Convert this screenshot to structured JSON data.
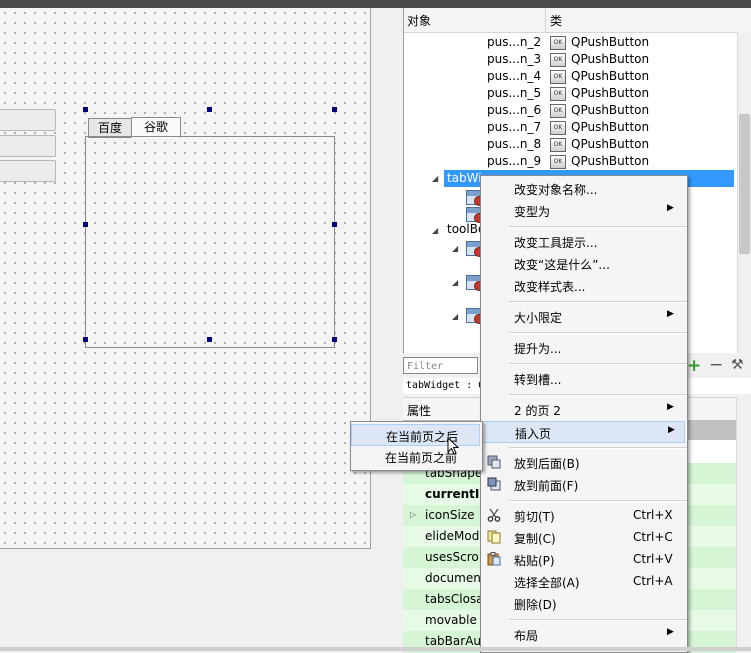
{
  "canvas": {
    "tabs": [
      "百度",
      "谷歌"
    ],
    "active_tab": 1
  },
  "object_inspector": {
    "header": {
      "col_object": "对象",
      "col_class": "类"
    },
    "rows": [
      {
        "name": "pus...n_2",
        "class": "QPushButton"
      },
      {
        "name": "pus...n_3",
        "class": "QPushButton"
      },
      {
        "name": "pus...n_4",
        "class": "QPushButton"
      },
      {
        "name": "pus...n_5",
        "class": "QPushButton"
      },
      {
        "name": "pus...n_6",
        "class": "QPushButton"
      },
      {
        "name": "pus...n_7",
        "class": "QPushButton"
      },
      {
        "name": "pus...n_8",
        "class": "QPushButton"
      },
      {
        "name": "pus...n_9",
        "class": "QPushButton"
      }
    ],
    "icon_label": "OK",
    "tab_widget_name": "tabWi",
    "toolbox_name": "toolBo"
  },
  "filter": {
    "placeholder": "Filter"
  },
  "property_editor": {
    "subtitle": "tabWidget : Q",
    "header": "属性",
    "rows": [
      {
        "name": "tabShape",
        "bold": false
      },
      {
        "name": "currentIn",
        "bold": true
      },
      {
        "name": "iconSize",
        "bold": false
      },
      {
        "name": "elideMod",
        "bold": false
      },
      {
        "name": "usesScro",
        "bold": false
      },
      {
        "name": "documen",
        "bold": false
      },
      {
        "name": "tabsClosa",
        "bold": false
      },
      {
        "name": "movable",
        "bold": false
      },
      {
        "name": "tabBarAu",
        "bold": false
      }
    ],
    "add_symbol": "+",
    "remove_symbol": "−"
  },
  "context_menu": {
    "items": [
      {
        "label": "改变对象名称...",
        "shortcut": "",
        "submenu": false
      },
      {
        "label": "变型为",
        "shortcut": "",
        "submenu": true
      },
      {
        "sep": true
      },
      {
        "label": "改变工具提示...",
        "shortcut": "",
        "submenu": false
      },
      {
        "label": "改变“这是什么”...",
        "shortcut": "",
        "submenu": false
      },
      {
        "label": "改变样式表...",
        "shortcut": "",
        "submenu": false
      },
      {
        "sep": true
      },
      {
        "label": "大小限定",
        "shortcut": "",
        "submenu": true
      },
      {
        "sep": true
      },
      {
        "label": "提升为...",
        "shortcut": "",
        "submenu": false
      },
      {
        "sep": true
      },
      {
        "label": "转到槽...",
        "shortcut": "",
        "submenu": false
      },
      {
        "sep": true
      },
      {
        "label": "2 的页 2",
        "shortcut": "",
        "submenu": true
      },
      {
        "label": "插入页",
        "shortcut": "",
        "submenu": true,
        "highlighted": true
      },
      {
        "sep": true
      },
      {
        "label": "放到后面(B)",
        "shortcut": "",
        "submenu": false,
        "icon": "send-back-icon"
      },
      {
        "label": "放到前面(F)",
        "shortcut": "",
        "submenu": false,
        "icon": "bring-front-icon"
      },
      {
        "sep": true
      },
      {
        "label": "剪切(T)",
        "shortcut": "Ctrl+X",
        "submenu": false,
        "icon": "scissors-icon"
      },
      {
        "label": "复制(C)",
        "shortcut": "Ctrl+C",
        "submenu": false,
        "icon": "copy-icon"
      },
      {
        "label": "粘贴(P)",
        "shortcut": "Ctrl+V",
        "submenu": false,
        "icon": "paste-icon"
      },
      {
        "label": "选择全部(A)",
        "shortcut": "Ctrl+A",
        "submenu": false
      },
      {
        "label": "删除(D)",
        "shortcut": "",
        "submenu": false
      },
      {
        "sep": true
      },
      {
        "label": "布局",
        "shortcut": "",
        "submenu": true
      }
    ]
  },
  "insert_submenu": {
    "items": [
      {
        "label": "在当前页之后",
        "highlighted": true
      },
      {
        "label": "在当前页之前",
        "highlighted": false
      }
    ]
  }
}
